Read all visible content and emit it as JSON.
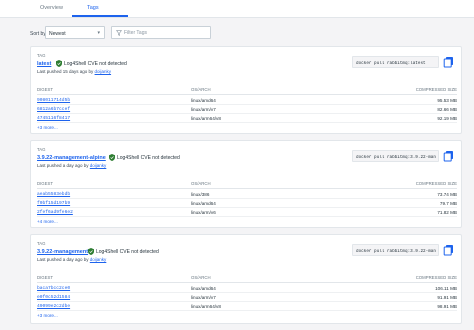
{
  "tabs": {
    "overview": "Overview",
    "tags": "Tags"
  },
  "toolbar": {
    "sort_label": "Sort by",
    "sort_value": "Newest",
    "filter_placeholder": "Filter Tags"
  },
  "columns": {
    "tag": "TAG",
    "digest": "DIGEST",
    "os_arch": "OS/ARCH",
    "compressed_size": "COMPRESSED SIZE"
  },
  "cards": [
    {
      "tag": "latest",
      "log4shell": "Log4Shell CVE not detected",
      "pushed_text": "Last pushed 15 days ago by ",
      "pushed_user": "doijanky",
      "pull_command": "docker pull rabbitmq:latest",
      "rows": [
        {
          "digest": "908011714d5b",
          "os": "linux/amd64",
          "size": "95.53 MB"
        },
        {
          "digest": "6812a6b7ccef",
          "os": "linux/arm/v7",
          "size": "82.66 MB"
        },
        {
          "digest": "4745116f8417",
          "os": "linux/arm64/v8",
          "size": "92.19 MB"
        }
      ],
      "more": "+3 more..."
    },
    {
      "tag": "3.9.22-management-alpine",
      "log4shell": "Log4Shell CVE not detected",
      "pushed_text": "Last pushed a day ago by ",
      "pushed_user": "doijanky",
      "pull_command": "docker pull rabbitmq:3.9.22-management-alpine",
      "rows": [
        {
          "digest": "aeab5583ebdb",
          "os": "linux/386",
          "size": "73.74 MB"
        },
        {
          "digest": "f0bf15d197b9",
          "os": "linux/amd64",
          "size": "79.7 MB"
        },
        {
          "digest": "2fef6ad9fe6e2",
          "os": "linux/arm/v6",
          "size": "71.82 MB"
        }
      ],
      "more": "+4 more..."
    },
    {
      "tag": "3.9.22-management",
      "log4shell": "Log4Shell CVE not detected",
      "pushed_text": "Last pushed a day ago by ",
      "pushed_user": "doijanky",
      "pull_command": "docker pull rabbitmq:3.9.22-management",
      "rows": [
        {
          "digest": "baca7bcc2ce0",
          "os": "linux/amd64",
          "size": "106.11 MB"
        },
        {
          "digest": "e0f0c52d1584",
          "os": "linux/arm/v7",
          "size": "91.91 MB"
        },
        {
          "digest": "49099e2c2dbe",
          "os": "linux/arm64/v8",
          "size": "98.91 MB"
        }
      ],
      "more": "+3 more..."
    }
  ],
  "colors": {
    "accent": "#1d63ed",
    "shield": "#2e7d32",
    "background": "#f4f4f6"
  }
}
